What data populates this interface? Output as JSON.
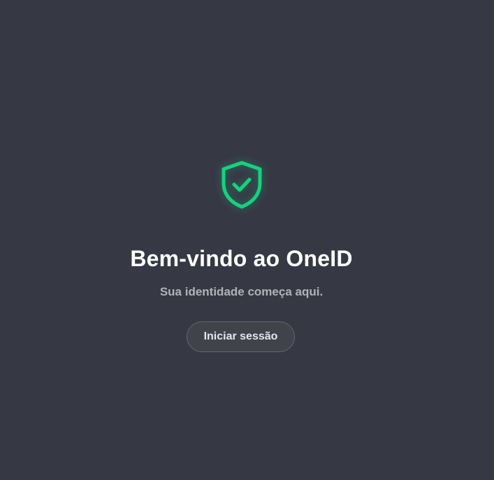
{
  "welcome": {
    "icon": "shield-check-icon",
    "accent_color": "#14d27f",
    "title": "Bem-vindo ao OneID",
    "subtitle": "Sua identidade começa aqui.",
    "login_button_label": "Iniciar sessão"
  }
}
